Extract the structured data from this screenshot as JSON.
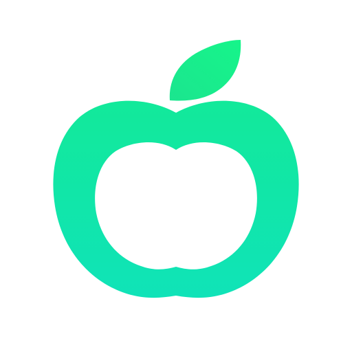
{
  "logo": {
    "icon": "apple-icon",
    "colors": {
      "leaf_top": "#16F58A",
      "leaf_bottom": "#1BE58F",
      "body_top": "#12E99A",
      "body_bottom": "#10E3B8",
      "background": "#FFFFFF"
    }
  }
}
